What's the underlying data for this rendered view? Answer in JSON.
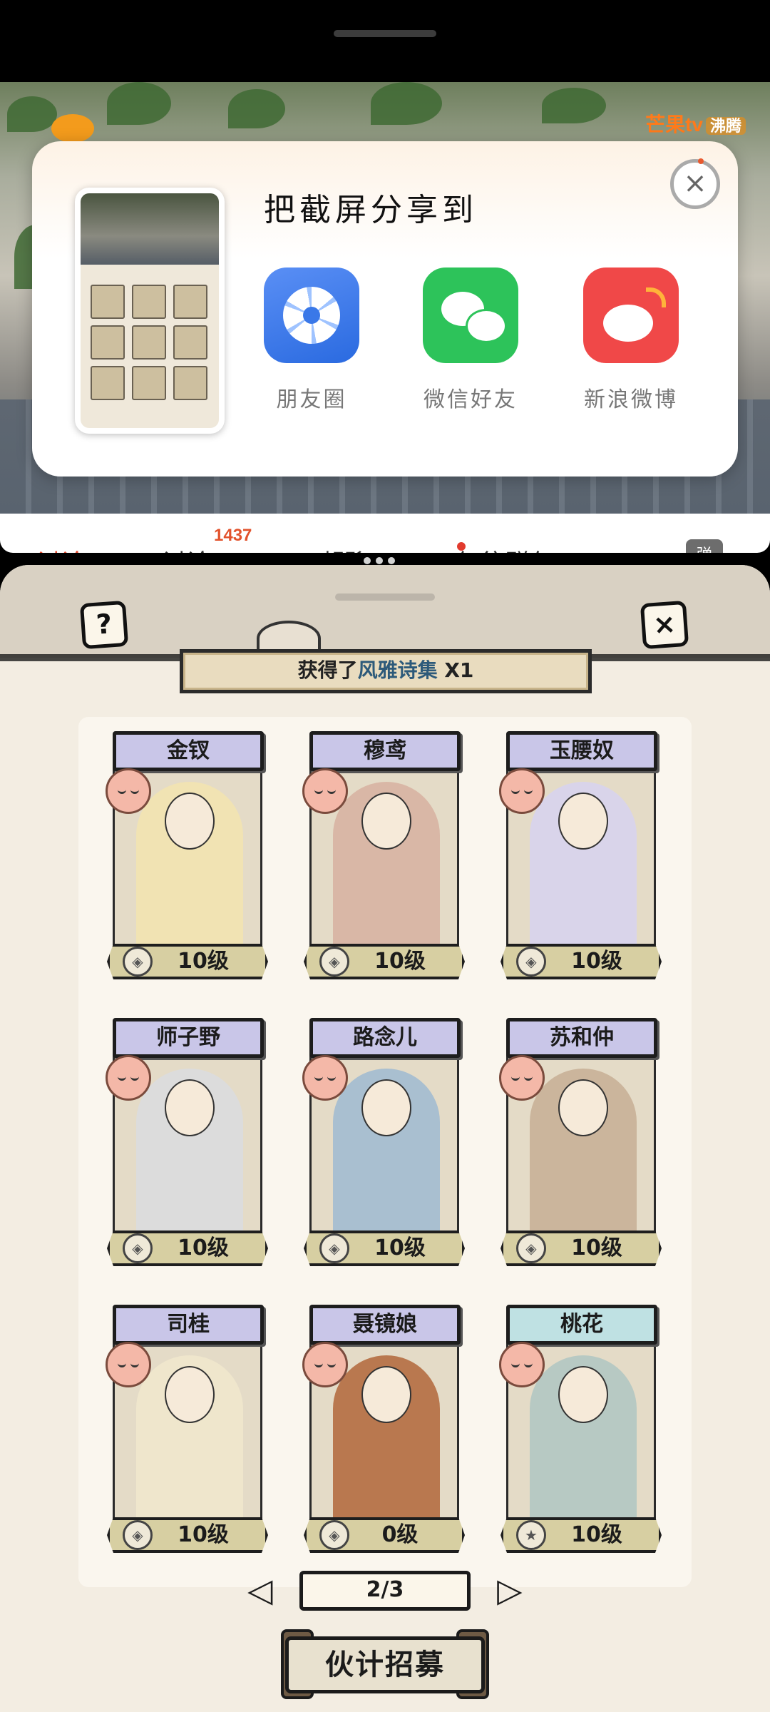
{
  "video": {
    "channel_logo": "芒果tv",
    "channel_brand": "沸腾"
  },
  "tabs": {
    "items": [
      "讨论",
      "讨论",
      "起聊",
      "红往群久",
      "弹"
    ],
    "badge": "1437"
  },
  "share": {
    "title": "把截屏分享到",
    "close_icon": "×",
    "options": [
      {
        "label": "朋友圈",
        "icon": "moments-icon"
      },
      {
        "label": "微信好友",
        "icon": "wechat-icon"
      },
      {
        "label": "新浪微博",
        "icon": "weibo-icon"
      }
    ]
  },
  "game": {
    "help_label": "?",
    "close_label": "×",
    "reward_prefix": "获得了",
    "reward_item": "风雅诗集",
    "reward_suffix": " X1",
    "cards": [
      {
        "name": "金钗",
        "level": "10级"
      },
      {
        "name": "穆鸢",
        "level": "10级"
      },
      {
        "name": "玉腰奴",
        "level": "10级"
      },
      {
        "name": "师子野",
        "level": "10级"
      },
      {
        "name": "路念儿",
        "level": "10级"
      },
      {
        "name": "苏和仲",
        "level": "10级"
      },
      {
        "name": "司桂",
        "level": "10级"
      },
      {
        "name": "聂镜娘",
        "level": "0级"
      },
      {
        "name": "桃花",
        "level": "10级"
      }
    ],
    "pager": "2/3",
    "prev_label": "◁",
    "next_label": "▷",
    "recruit_label": "伙计招募"
  }
}
